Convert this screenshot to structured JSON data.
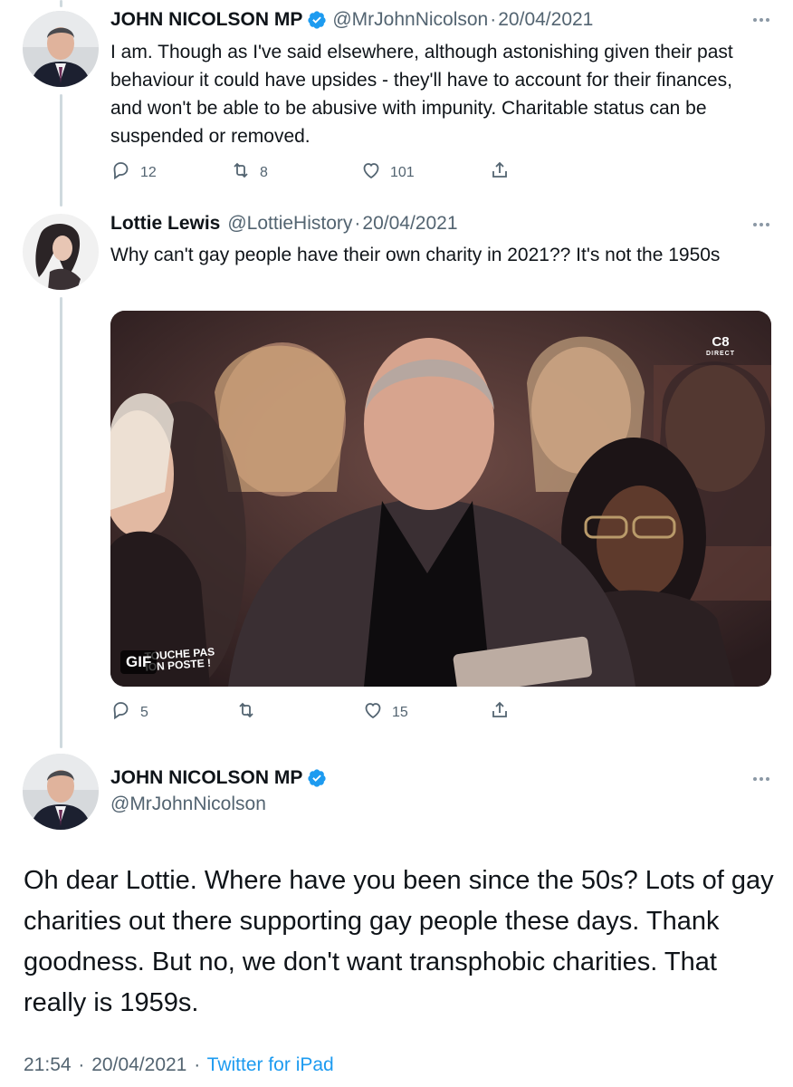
{
  "tweet1": {
    "name": "JOHN NICOLSON MP",
    "handle": "@MrJohnNicolson",
    "date": "20/04/2021",
    "text": "I am. Though as I've said elsewhere, although astonishing given their past behaviour it could have upsides - they'll have to account for their finances, and won't be able to be abusive with impunity. Charitable status can be suspended or removed.",
    "replies": "12",
    "retweets": "8",
    "likes": "101"
  },
  "tweet2": {
    "name": "Lottie Lewis",
    "handle": "@LottieHistory",
    "date": "20/04/2021",
    "text": "Why can't gay people have their own charity in 2021?? It's not the 1950s",
    "media_badge": "GIF",
    "media_logo_top": "C8",
    "media_logo_sub": "DIRECT",
    "media_show_line1": "TOUCHE PAS",
    "media_show_line2": "ION POSTE !",
    "replies": "5",
    "retweets": "",
    "likes": "15"
  },
  "main_tweet": {
    "name": "JOHN NICOLSON MP",
    "handle": "@MrJohnNicolson",
    "text": "Oh dear Lottie. Where have you been since the 50s? Lots of gay charities out there supporting gay people these days. Thank goodness. But no, we don't want transphobic charities. That really is 1959s.",
    "time": "21:54",
    "date": "20/04/2021",
    "source": "Twitter for iPad"
  },
  "separator": "·",
  "colors": {
    "accent": "#1d9bf0",
    "muted": "#536471",
    "thread": "#cfd9de"
  },
  "icons": [
    "verified-badge-icon",
    "more-options-icon",
    "reply-icon",
    "retweet-icon",
    "like-icon",
    "share-icon"
  ]
}
